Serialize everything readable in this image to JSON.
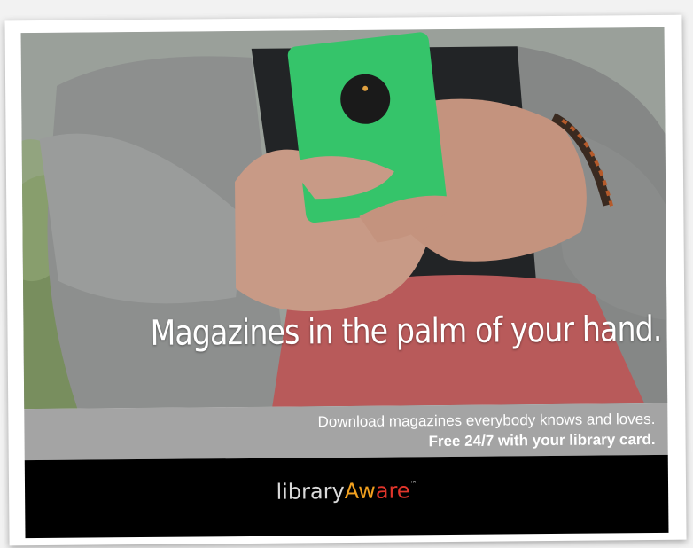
{
  "banner": {
    "headline": "Magazines in the palm of your hand.",
    "subline1": "Download magazines everybody knows and loves.",
    "subline2": "Free 24/7 with your library card."
  },
  "logo": {
    "part1": "library",
    "part2": "Aw",
    "part3": "are",
    "trademark": "™"
  },
  "colors": {
    "phone": "#35c46a",
    "logo_library": "#d9d9d9",
    "logo_aw": "#f2a11f",
    "logo_are": "#e1352b",
    "subband": "#a4a4a4",
    "footer": "#000000"
  }
}
